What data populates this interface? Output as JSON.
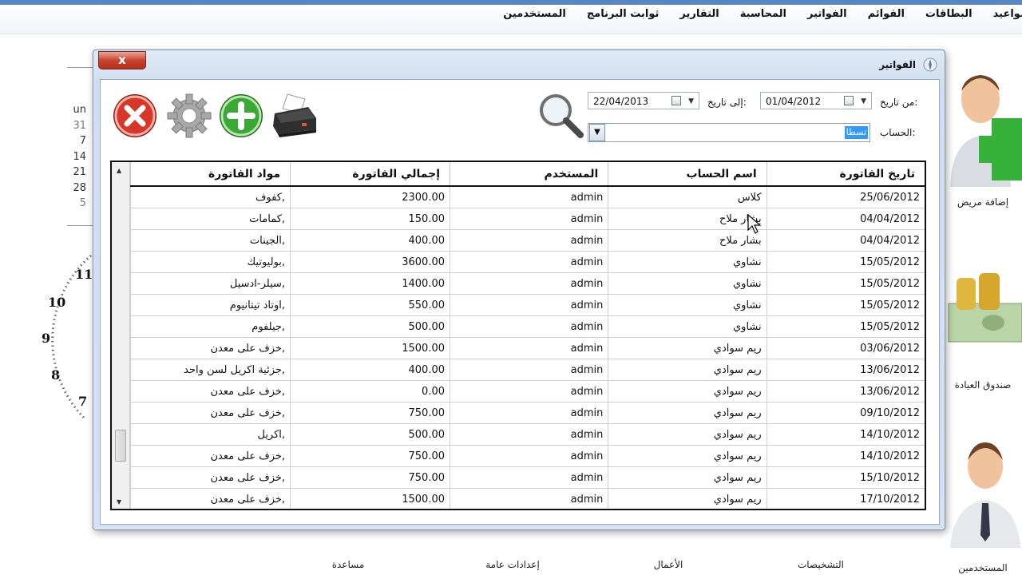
{
  "menu": {
    "items": [
      "مواعيد",
      "البطاقات",
      "القوائم",
      "الفواتير",
      "المحاسبة",
      "التقارير",
      "ثوابت البرنامج",
      "المستخدمين"
    ]
  },
  "background": {
    "calendar": {
      "header": "un",
      "days": [
        "31",
        "7",
        "14",
        "21",
        "28",
        "5"
      ]
    },
    "clock_numbers": [
      "11",
      "10",
      "9",
      "8",
      "7"
    ],
    "side_tiles": [
      "إضافة مريض",
      "صندوق العيادة",
      "المستخدمين"
    ],
    "bottom_tiles": [
      "مساعدة",
      "إعدادات عامة",
      "الأعمال",
      "التشخيصات"
    ]
  },
  "window": {
    "title": "الفواتير",
    "close_label": "x",
    "from_date_label": "من تاريخ:",
    "from_date_value": "01/04/2012",
    "to_date_label": "إلى تاريخ:",
    "to_date_value": "22/04/2013",
    "account_label": "الحساب:",
    "account_selected": "تسطا",
    "dropdown_glyph": "▼"
  },
  "grid": {
    "columns": [
      "تاريخ الفاتورة",
      "اسم الحساب",
      "المستخدم",
      "إجمالي الفاتورة",
      "مواد الفاتورة"
    ],
    "rows": [
      {
        "date": "25/06/2012",
        "account": "كلاس",
        "user": "admin",
        "total": "2300.00",
        "materials": ",كفوف"
      },
      {
        "date": "04/04/2012",
        "account": "بشار ملاح",
        "user": "admin",
        "total": "150.00",
        "materials": ",كمامات"
      },
      {
        "date": "04/04/2012",
        "account": "بشار ملاح",
        "user": "admin",
        "total": "400.00",
        "materials": ",الجينات"
      },
      {
        "date": "15/05/2012",
        "account": "نشاوي",
        "user": "admin",
        "total": "3600.00",
        "materials": ",بوليوتيك"
      },
      {
        "date": "15/05/2012",
        "account": "نشاوي",
        "user": "admin",
        "total": "1400.00",
        "materials": ",سيلر-ادسيل"
      },
      {
        "date": "15/05/2012",
        "account": "نشاوي",
        "user": "admin",
        "total": "550.00",
        "materials": ",اوتاد تيتانيوم"
      },
      {
        "date": "15/05/2012",
        "account": "نشاوي",
        "user": "admin",
        "total": "500.00",
        "materials": ",جيلفوم"
      },
      {
        "date": "03/06/2012",
        "account": "ريم سوادي",
        "user": "admin",
        "total": "1500.00",
        "materials": ",خزف على معدن"
      },
      {
        "date": "13/06/2012",
        "account": "ريم سوادي",
        "user": "admin",
        "total": "400.00",
        "materials": ",جزئية اكريل لسن واحد"
      },
      {
        "date": "13/06/2012",
        "account": "ريم سوادي",
        "user": "admin",
        "total": "0.00",
        "materials": ",خزف على معدن"
      },
      {
        "date": "09/10/2012",
        "account": "ريم سوادي",
        "user": "admin",
        "total": "750.00",
        "materials": ",خزف على معدن"
      },
      {
        "date": "14/10/2012",
        "account": "ريم سوادي",
        "user": "admin",
        "total": "500.00",
        "materials": ",اكريل"
      },
      {
        "date": "14/10/2012",
        "account": "ريم سوادي",
        "user": "admin",
        "total": "750.00",
        "materials": ",خزف على معدن"
      },
      {
        "date": "15/10/2012",
        "account": "ريم سوادي",
        "user": "admin",
        "total": "750.00",
        "materials": ",خزف على معدن"
      },
      {
        "date": "17/10/2012",
        "account": "ريم سوادي",
        "user": "admin",
        "total": "1500.00",
        "materials": ",خزف على معدن"
      }
    ]
  },
  "colors": {
    "accent": "#5b86c4",
    "close_red": "#c9452f",
    "add_green": "#2f9a2a",
    "selection": "#3399ff"
  },
  "icons": {
    "toolbar": [
      "close-circle-icon",
      "gear-icon",
      "add-icon",
      "printer-icon"
    ],
    "search": "magnifier-icon"
  }
}
